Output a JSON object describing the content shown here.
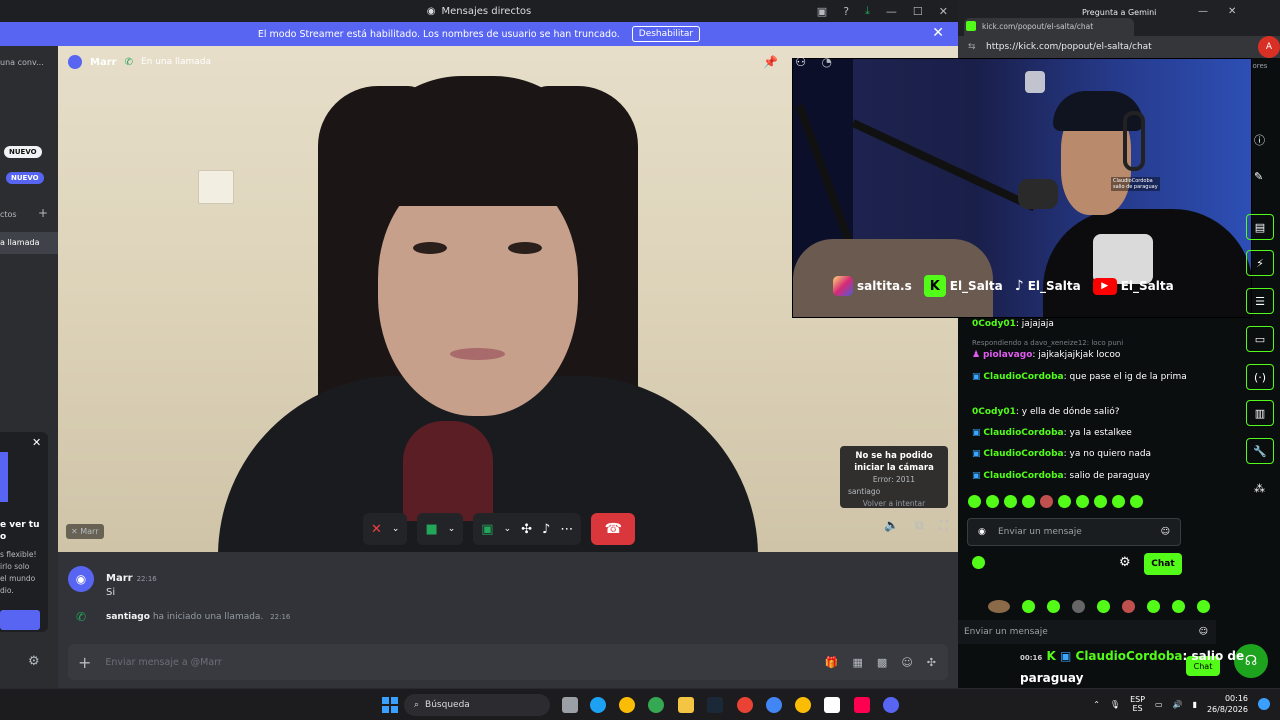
{
  "discord": {
    "window_title": "Mensajes directos",
    "streamer_bar": {
      "text": "El modo Streamer está habilitado. Los nombres de usuario se han truncado.",
      "button": "Deshabilitar"
    },
    "sidebar": {
      "item1": "una conv...",
      "badge_new1": "NUEVO",
      "badge_new2": "NUEVO",
      "section": "ctos",
      "item_call": "a llamada",
      "promo_l1": "e ver tu",
      "promo_l2": "o",
      "promo_l3": "s flexible!",
      "promo_l4": "irlo solo",
      "promo_l5": "el mundo",
      "promo_l6": "dio."
    },
    "call": {
      "user": "Marr",
      "status": "En una llamada",
      "self_tag": "Marr",
      "camera_error": {
        "l1": "No se ha podido",
        "l2": "iniciar la cámara",
        "code": "Error: 2011",
        "user": "santiago",
        "retry": "Volver a intentar"
      }
    },
    "messages": [
      {
        "user": "Marr",
        "time": "22:16",
        "text": "Si"
      },
      {
        "user": "santiago",
        "text": "ha iniciado una llamada.",
        "time": "22:16"
      }
    ],
    "composer_placeholder": "Enviar mensaje a @Marr"
  },
  "browser": {
    "tab": "kick.com/popout/el-salta/chat",
    "tab2": "Pregunta a Gemini",
    "url": "https://kick.com/popout/el-salta/chat",
    "url_small": "kick.com/popout/el-salta/chat",
    "misc": "dores",
    "avatar": "A"
  },
  "stream": {
    "handles": [
      {
        "icon": "instagram-icon",
        "name": "saltita.s"
      },
      {
        "icon": "kick-icon",
        "name": "El_Salta"
      },
      {
        "icon": "tiktok-icon",
        "name": "El_Salta"
      },
      {
        "icon": "youtube-icon",
        "name": "El_Salta"
      }
    ],
    "overlay_user": "ClaudioCordoba",
    "overlay_text": "salio de paraguay"
  },
  "kick_chat": {
    "messages": [
      {
        "user": "0Cody01",
        "text": "jajajaja"
      },
      {
        "reply": "Respondiendo a davo_xeneize12: loco puni"
      },
      {
        "user": "piolavago",
        "text": "jajkakjajkjak locoo"
      },
      {
        "user": "ClaudioCordoba",
        "text": "que pase el ig de la prima"
      },
      {
        "user": "0Cody01",
        "text": "y ella de dónde salió?"
      },
      {
        "user": "ClaudioCordoba",
        "text": "ya la estalkee"
      },
      {
        "user": "ClaudioCordoba",
        "text": "ya no quiero nada"
      },
      {
        "user": "ClaudioCordoba",
        "text": "salio de paraguay"
      }
    ],
    "input_placeholder": "Enviar un mensaje",
    "chat_button": "Chat",
    "input2_placeholder": "Enviar un mensaje",
    "chat_button2": "Chat",
    "overlay": {
      "time": "00:16",
      "user": "ClaudioCordoba",
      "text": ": salio de",
      "text2": "paraguay"
    }
  },
  "taskbar": {
    "search": "Búsqueda",
    "lang1": "ESP",
    "lang2": "ES",
    "time": "00:16",
    "date": "26/8/2026"
  }
}
